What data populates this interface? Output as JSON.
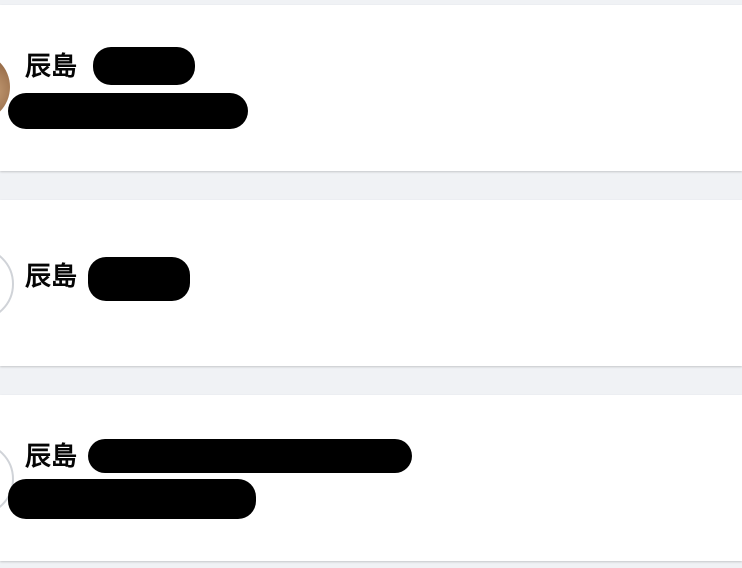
{
  "results": [
    {
      "name": "辰島"
    },
    {
      "name": "辰島"
    },
    {
      "name": "辰島"
    }
  ],
  "colors": {
    "page_background": "#f0f2f5",
    "card_background": "#ffffff",
    "name_text": "#050505",
    "redaction": "#000000"
  }
}
